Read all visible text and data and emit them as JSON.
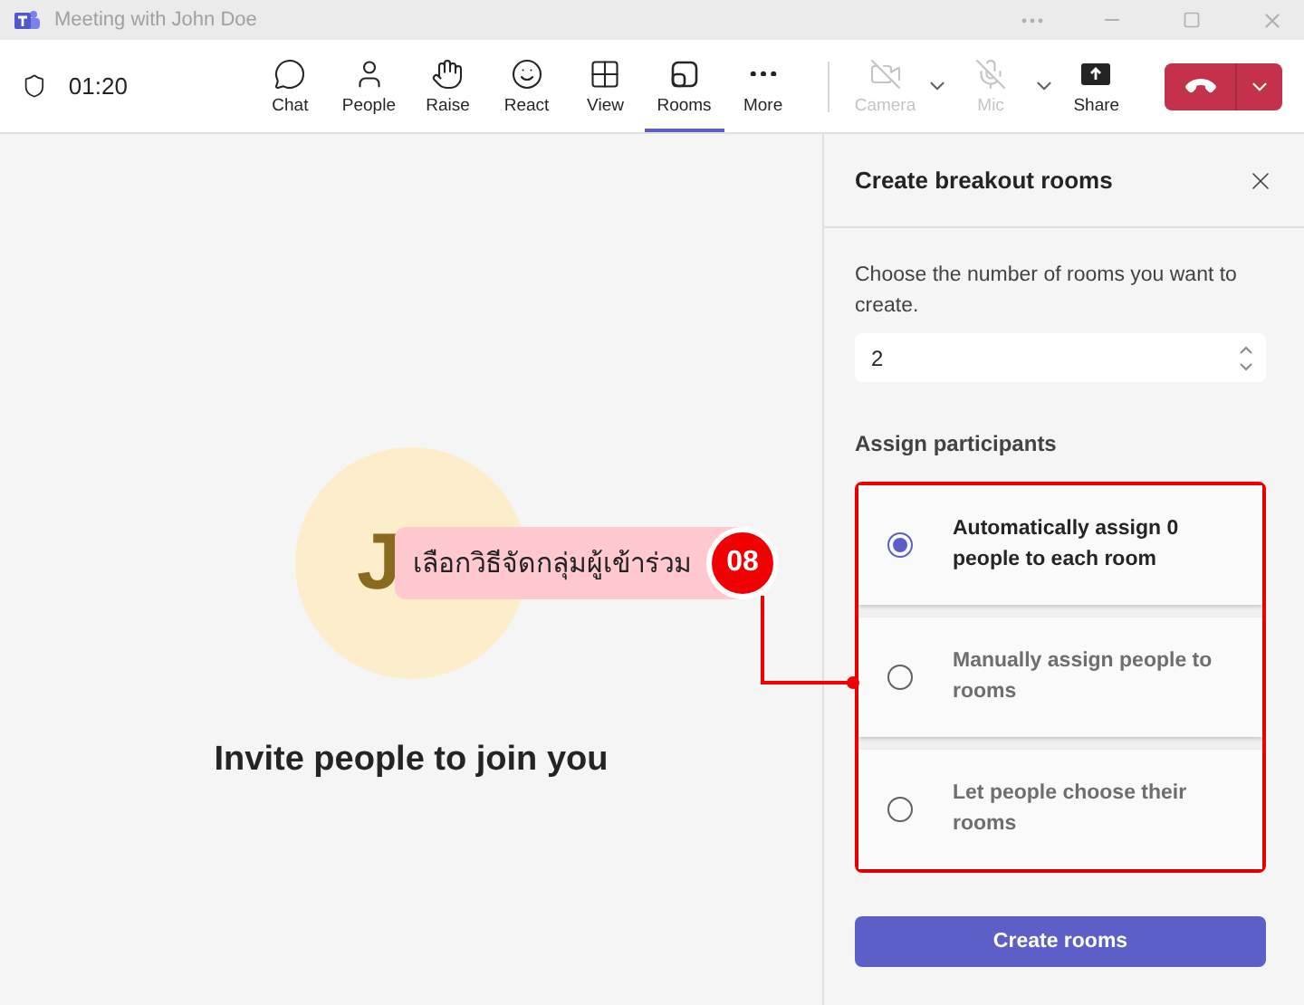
{
  "window": {
    "title": "Meeting with John Doe"
  },
  "toolbar": {
    "timer": "01:20",
    "items": [
      {
        "label": "Chat",
        "kind": "chat",
        "selected": false,
        "disabled": false,
        "menu": false
      },
      {
        "label": "People",
        "kind": "people",
        "selected": false,
        "disabled": false,
        "menu": false
      },
      {
        "label": "Raise",
        "kind": "raise",
        "selected": false,
        "disabled": false,
        "menu": false
      },
      {
        "label": "React",
        "kind": "react",
        "selected": false,
        "disabled": false,
        "menu": false
      },
      {
        "label": "View",
        "kind": "view",
        "selected": false,
        "disabled": false,
        "menu": false
      },
      {
        "label": "Rooms",
        "kind": "rooms",
        "selected": true,
        "disabled": false,
        "menu": false
      },
      {
        "label": "More",
        "kind": "more",
        "selected": false,
        "disabled": false,
        "menu": false
      },
      {
        "label": "Camera",
        "kind": "camera",
        "selected": false,
        "disabled": true,
        "menu": true
      },
      {
        "label": "Mic",
        "kind": "mic",
        "selected": false,
        "disabled": true,
        "menu": true
      },
      {
        "label": "Share",
        "kind": "share",
        "selected": false,
        "disabled": false,
        "menu": false
      }
    ]
  },
  "stage": {
    "initials": "J",
    "invite": "Invite people to join you"
  },
  "panel": {
    "title": "Create breakout rooms",
    "description": "Choose the number of rooms you want to create.",
    "room_count": "2",
    "section": "Assign participants",
    "options": [
      {
        "label": "Automatically assign 0 people to each room",
        "selected": true
      },
      {
        "label": "Manually assign people to rooms",
        "selected": false
      },
      {
        "label": "Let people choose their rooms",
        "selected": false
      }
    ],
    "button": "Create rooms"
  },
  "annotation": {
    "number": "08",
    "text": "เลือกวิธีจัดกลุ่มผู้เข้าร่วม"
  }
}
